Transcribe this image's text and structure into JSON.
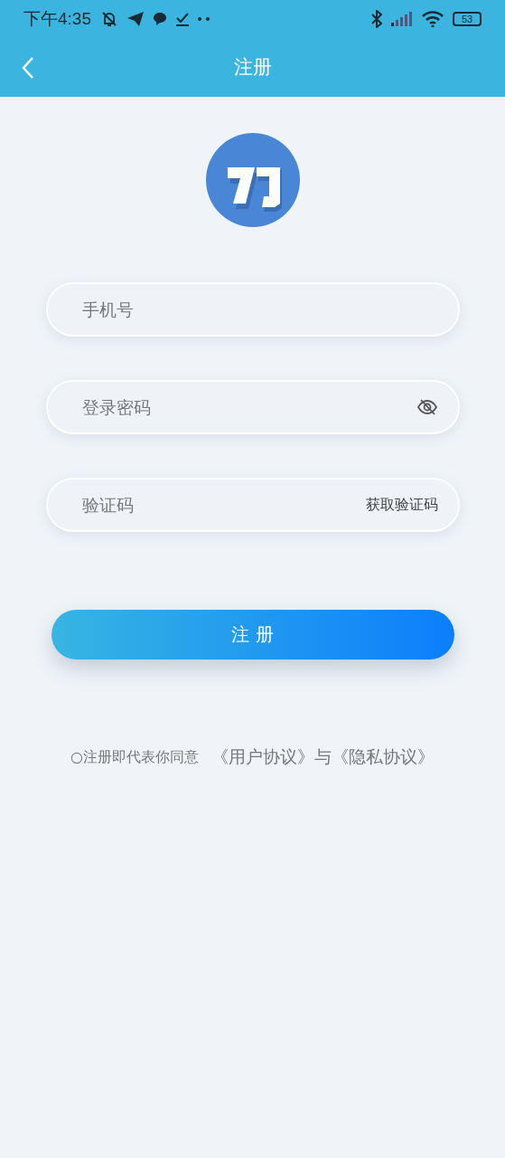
{
  "status_bar": {
    "time": "下午4:35",
    "battery": "53"
  },
  "app_bar": {
    "title": "注册"
  },
  "fields": [
    {
      "kind": "plain",
      "placeholder": "手机号"
    },
    {
      "kind": "password",
      "placeholder": "登录密码"
    },
    {
      "kind": "code",
      "placeholder": "验证码",
      "action": "获取验证码"
    }
  ],
  "submit_button": "注 册",
  "agreement": {
    "text": "○注册即代表你同意",
    "links": [
      "《用户协议》",
      "《隐私协议》"
    ],
    "joiner": "与"
  }
}
